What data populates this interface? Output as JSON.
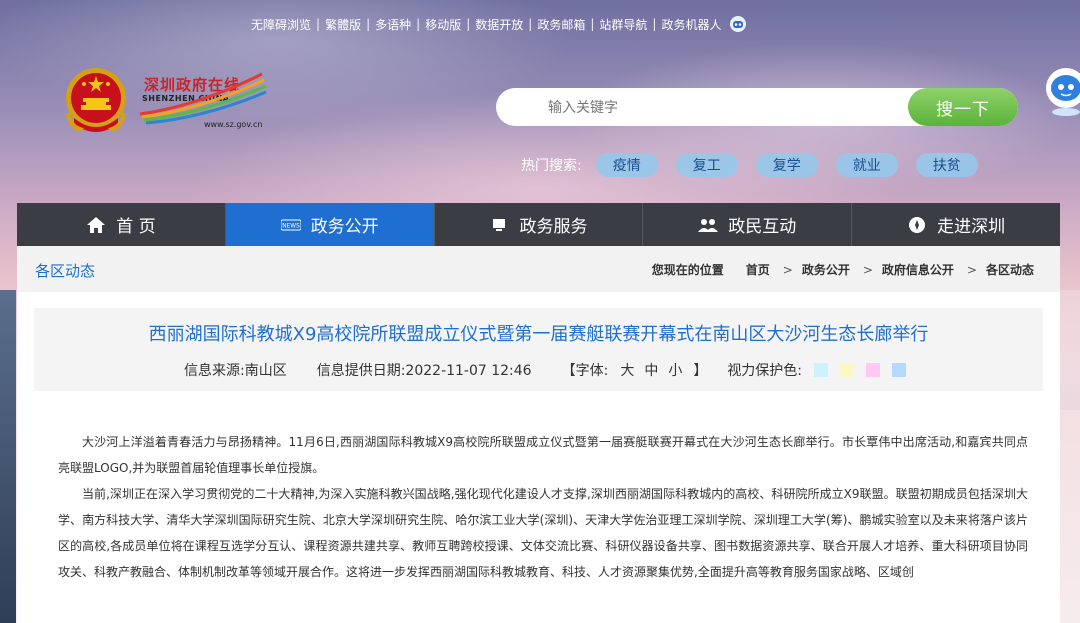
{
  "top_links": [
    "无障碍浏览",
    "繁體版",
    "多语种",
    "移动版",
    "数据开放",
    "政务邮箱",
    "站群导航",
    "政务机器人"
  ],
  "logo": {
    "cn": "深圳政府在线",
    "en": "SHENZHEN CHINA",
    "url": "www.sz.gov.cn"
  },
  "search": {
    "placeholder": "输入关键字",
    "button": "搜一下"
  },
  "hot": {
    "label": "热门搜索:",
    "tags": [
      "疫情",
      "复工",
      "复学",
      "就业",
      "扶贫"
    ]
  },
  "nav": [
    {
      "label": "首 页",
      "icon": "home-icon"
    },
    {
      "label": "政务公开",
      "icon": "news-icon"
    },
    {
      "label": "政务服务",
      "icon": "monitor-icon"
    },
    {
      "label": "政民互动",
      "icon": "people-icon"
    },
    {
      "label": "走进深圳",
      "icon": "compass-icon"
    }
  ],
  "section_title": "各区动态",
  "breadcrumb": {
    "prefix": "您现在的位置",
    "items": [
      "首页",
      "政务公开",
      "政府信息公开",
      "各区动态"
    ]
  },
  "article": {
    "title": "西丽湖国际科教城X9高校院所联盟成立仪式暨第一届赛艇联赛开幕式在南山区大沙河生态长廊举行",
    "source": "信息来源:南山区",
    "date": "信息提供日期:2022-11-07 12:46",
    "font_label": "【字体:",
    "font_sizes": [
      "大",
      "中",
      "小"
    ],
    "font_end": "】",
    "eye_label": "视力保护色:",
    "eye_colors": [
      "#ccf2ff",
      "#fbf8c4",
      "#ffc8f5",
      "#b3d9ff"
    ],
    "paragraphs": [
      "大沙河上洋溢着青春活力与昂扬精神。11月6日,西丽湖国际科教城X9高校院所联盟成立仪式暨第一届赛艇联赛开幕式在大沙河生态长廊举行。市长覃伟中出席活动,和嘉宾共同点亮联盟LOGO,并为联盟首届轮值理事长单位授旗。",
      "当前,深圳正在深入学习贯彻党的二十大精神,为深入实施科教兴国战略,强化现代化建设人才支撑,深圳西丽湖国际科教城内的高校、科研院所成立X9联盟。联盟初期成员包括深圳大学、南方科技大学、清华大学深圳国际研究生院、北京大学深圳研究生院、哈尔滨工业大学(深圳)、天津大学佐治亚理工深圳学院、深圳理工大学(筹)、鹏城实验室以及未来将落户该片区的高校,各成员单位将在课程互选学分互认、课程资源共建共享、教师互聘跨校授课、文体交流比赛、科研仪器设备共享、图书数据资源共享、联合开展人才培养、重大科研项目协同攻关、科教产教融合、体制机制改革等领域开展合作。这将进一步发挥西丽湖国际科教城教育、科技、人才资源聚集优势,全面提升高等教育服务国家战略、区域创"
    ]
  }
}
